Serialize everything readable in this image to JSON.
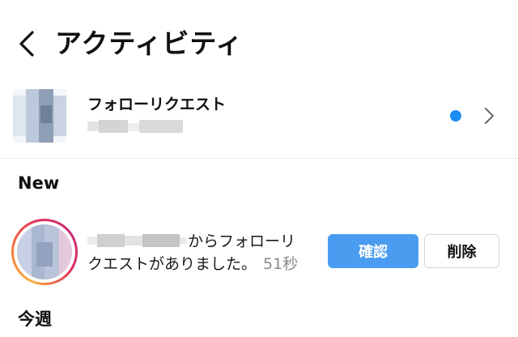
{
  "header": {
    "title": "アクティビティ"
  },
  "follow_requests": {
    "title": "フォローリクエスト",
    "unread_color": "#1c8ef0"
  },
  "sections": {
    "new": "New",
    "this_week": "今週"
  },
  "notification": {
    "message_part1": "からフォローリ",
    "message_part2": "クエストがありました。",
    "time": "51秒",
    "confirm_label": "確認",
    "delete_label": "削除"
  },
  "colors": {
    "accent": "#4a9cf0",
    "dot": "#1c8ef0"
  }
}
